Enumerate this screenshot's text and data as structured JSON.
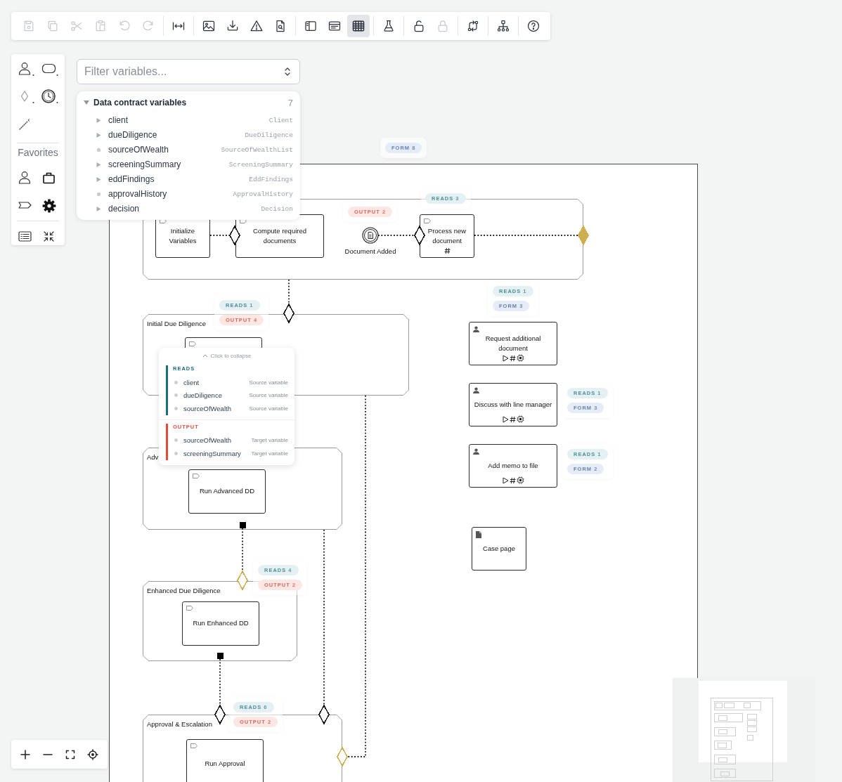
{
  "toolbar": {
    "groups": [
      [
        {
          "disabled": true
        },
        {
          "disabled": true
        },
        {
          "disabled": true
        },
        {
          "disabled": true
        },
        {
          "disabled": true
        },
        {
          "disabled": true
        }
      ],
      [
        {
          "disabled": false
        }
      ],
      [
        {
          "disabled": false
        },
        {
          "disabled": false
        },
        {
          "disabled": false
        },
        {
          "disabled": false
        }
      ],
      [
        {
          "disabled": false,
          "selected": false
        },
        {
          "disabled": false,
          "selected": false
        },
        {
          "disabled": false,
          "selected": true
        }
      ],
      [
        {
          "disabled": false
        }
      ],
      [
        {
          "disabled": false
        },
        {
          "disabled": true
        }
      ],
      [
        {
          "disabled": false
        }
      ],
      [
        {
          "disabled": false
        }
      ],
      [
        {
          "disabled": false
        }
      ]
    ]
  },
  "palette": {
    "favorites_label": "Favorites"
  },
  "filter": {
    "placeholder": "Filter variables..."
  },
  "variables": {
    "title": "Data contract variables",
    "count": "7",
    "expanded": true,
    "items": [
      {
        "name": "client",
        "type": "Client",
        "expandable": true
      },
      {
        "name": "dueDiligence",
        "type": "DueDiligence",
        "expandable": true
      },
      {
        "name": "sourceOfWealth",
        "type": "SourceOfWealthList",
        "expandable": false
      },
      {
        "name": "screeningSummary",
        "type": "ScreeningSummary",
        "expandable": true
      },
      {
        "name": "eddFindings",
        "type": "EddFindings",
        "expandable": true
      },
      {
        "name": "approvalHistory",
        "type": "ApprovalHistory",
        "expandable": false
      },
      {
        "name": "decision",
        "type": "Decision",
        "expandable": true
      }
    ]
  },
  "diagram": {
    "frame_badges": [
      {
        "kind": "form",
        "label": "FORM",
        "count": "8"
      }
    ],
    "subprocesses": [
      {
        "end_marker": false,
        "tasks": [
          {
            "kind": "task",
            "label": "Initialize Variables"
          },
          {
            "kind": "task",
            "label": "Compute required documents"
          },
          {
            "kind": "event",
            "label": "Document Added",
            "badges": [
              {
                "kind": "output",
                "label": "OUTPUT",
                "count": "2"
              }
            ]
          },
          {
            "kind": "task",
            "label": "Process new document",
            "markers": [
              {
                "kind": "hash"
              }
            ],
            "badges": [
              {
                "kind": "reads",
                "label": "READS",
                "count": "3"
              }
            ]
          }
        ]
      },
      {
        "label": "Initial Due Diligence",
        "end_marker": false,
        "badges": [
          {
            "kind": "reads",
            "label": "READS",
            "count": "1"
          },
          {
            "kind": "output",
            "label": "OUTPUT",
            "count": "4"
          }
        ],
        "tasks": [
          {
            "kind": "task"
          }
        ]
      },
      {
        "label": "Adv",
        "end_marker": true,
        "tasks": [
          {
            "kind": "task",
            "label": "Run Advanced DD"
          }
        ]
      },
      {
        "label": "Enhanced Due Diligence",
        "end_marker": true,
        "badges": [
          {
            "kind": "reads",
            "label": "READS",
            "count": "4"
          },
          {
            "kind": "output",
            "label": "OUTPUT",
            "count": "2"
          }
        ],
        "tasks": [
          {
            "kind": "task",
            "label": "Run Enhanced DD"
          }
        ]
      },
      {
        "label": "Approval & Escalation",
        "end_marker": false,
        "badges": [
          {
            "kind": "reads",
            "label": "READS",
            "count": "6"
          },
          {
            "kind": "output",
            "label": "OUTPUT",
            "count": "2"
          }
        ],
        "tasks": [
          {
            "kind": "task",
            "label": "Run Approval"
          }
        ]
      }
    ],
    "side_tasks": [
      {
        "kind": "user_task",
        "label": "Request additional document",
        "markers": [
          {
            "kind": "play"
          },
          {
            "kind": "hash"
          },
          {
            "kind": "ai"
          }
        ],
        "badges": [
          {
            "kind": "reads",
            "label": "READS",
            "count": "1"
          },
          {
            "kind": "form",
            "label": "FORM",
            "count": "3"
          }
        ]
      },
      {
        "kind": "user_task",
        "label": "Discuss with line manager",
        "markers": [
          {
            "kind": "play"
          },
          {
            "kind": "hash"
          },
          {
            "kind": "ai"
          }
        ],
        "badges": [
          {
            "kind": "reads",
            "label": "READS",
            "count": "1"
          },
          {
            "kind": "form",
            "label": "FORM",
            "count": "3"
          }
        ]
      },
      {
        "kind": "user_task",
        "label": "Add memo to file",
        "markers": [
          {
            "kind": "play"
          },
          {
            "kind": "hash"
          },
          {
            "kind": "ai"
          }
        ],
        "badges": [
          {
            "kind": "reads",
            "label": "READS",
            "count": "1"
          },
          {
            "kind": "form",
            "label": "FORM",
            "count": "2"
          }
        ]
      },
      {
        "kind": "page",
        "label": "Case page"
      }
    ],
    "gateways": [
      {
        "color": "#1a1a1a",
        "filled": false
      },
      {
        "color": "#1a1a1a",
        "filled": false
      },
      {
        "color": "#cfae4f",
        "filled": true
      },
      {
        "color": "#1a1a1a",
        "filled": false
      },
      {
        "color": "#cfae4f",
        "filled": false
      },
      {
        "color": "#1a1a1a",
        "filled": false
      },
      {
        "color": "#1a1a1a",
        "filled": false
      },
      {
        "color": "#cfae4f",
        "filled": false
      }
    ],
    "popup": {
      "collapse_label": "Click to collapse",
      "sections": [
        {
          "kind": "reads",
          "title": "READS",
          "rows": [
            {
              "name": "client",
              "role": "Source variable"
            },
            {
              "name": "dueDiligence",
              "role": "Source variable"
            },
            {
              "name": "sourceOfWealth",
              "role": "Source variable"
            }
          ]
        },
        {
          "kind": "output",
          "title": "OUTPUT",
          "rows": [
            {
              "name": "sourceOfWealth",
              "role": "Target variable"
            },
            {
              "name": "screeningSummary",
              "role": "Target variable"
            }
          ]
        }
      ]
    }
  }
}
